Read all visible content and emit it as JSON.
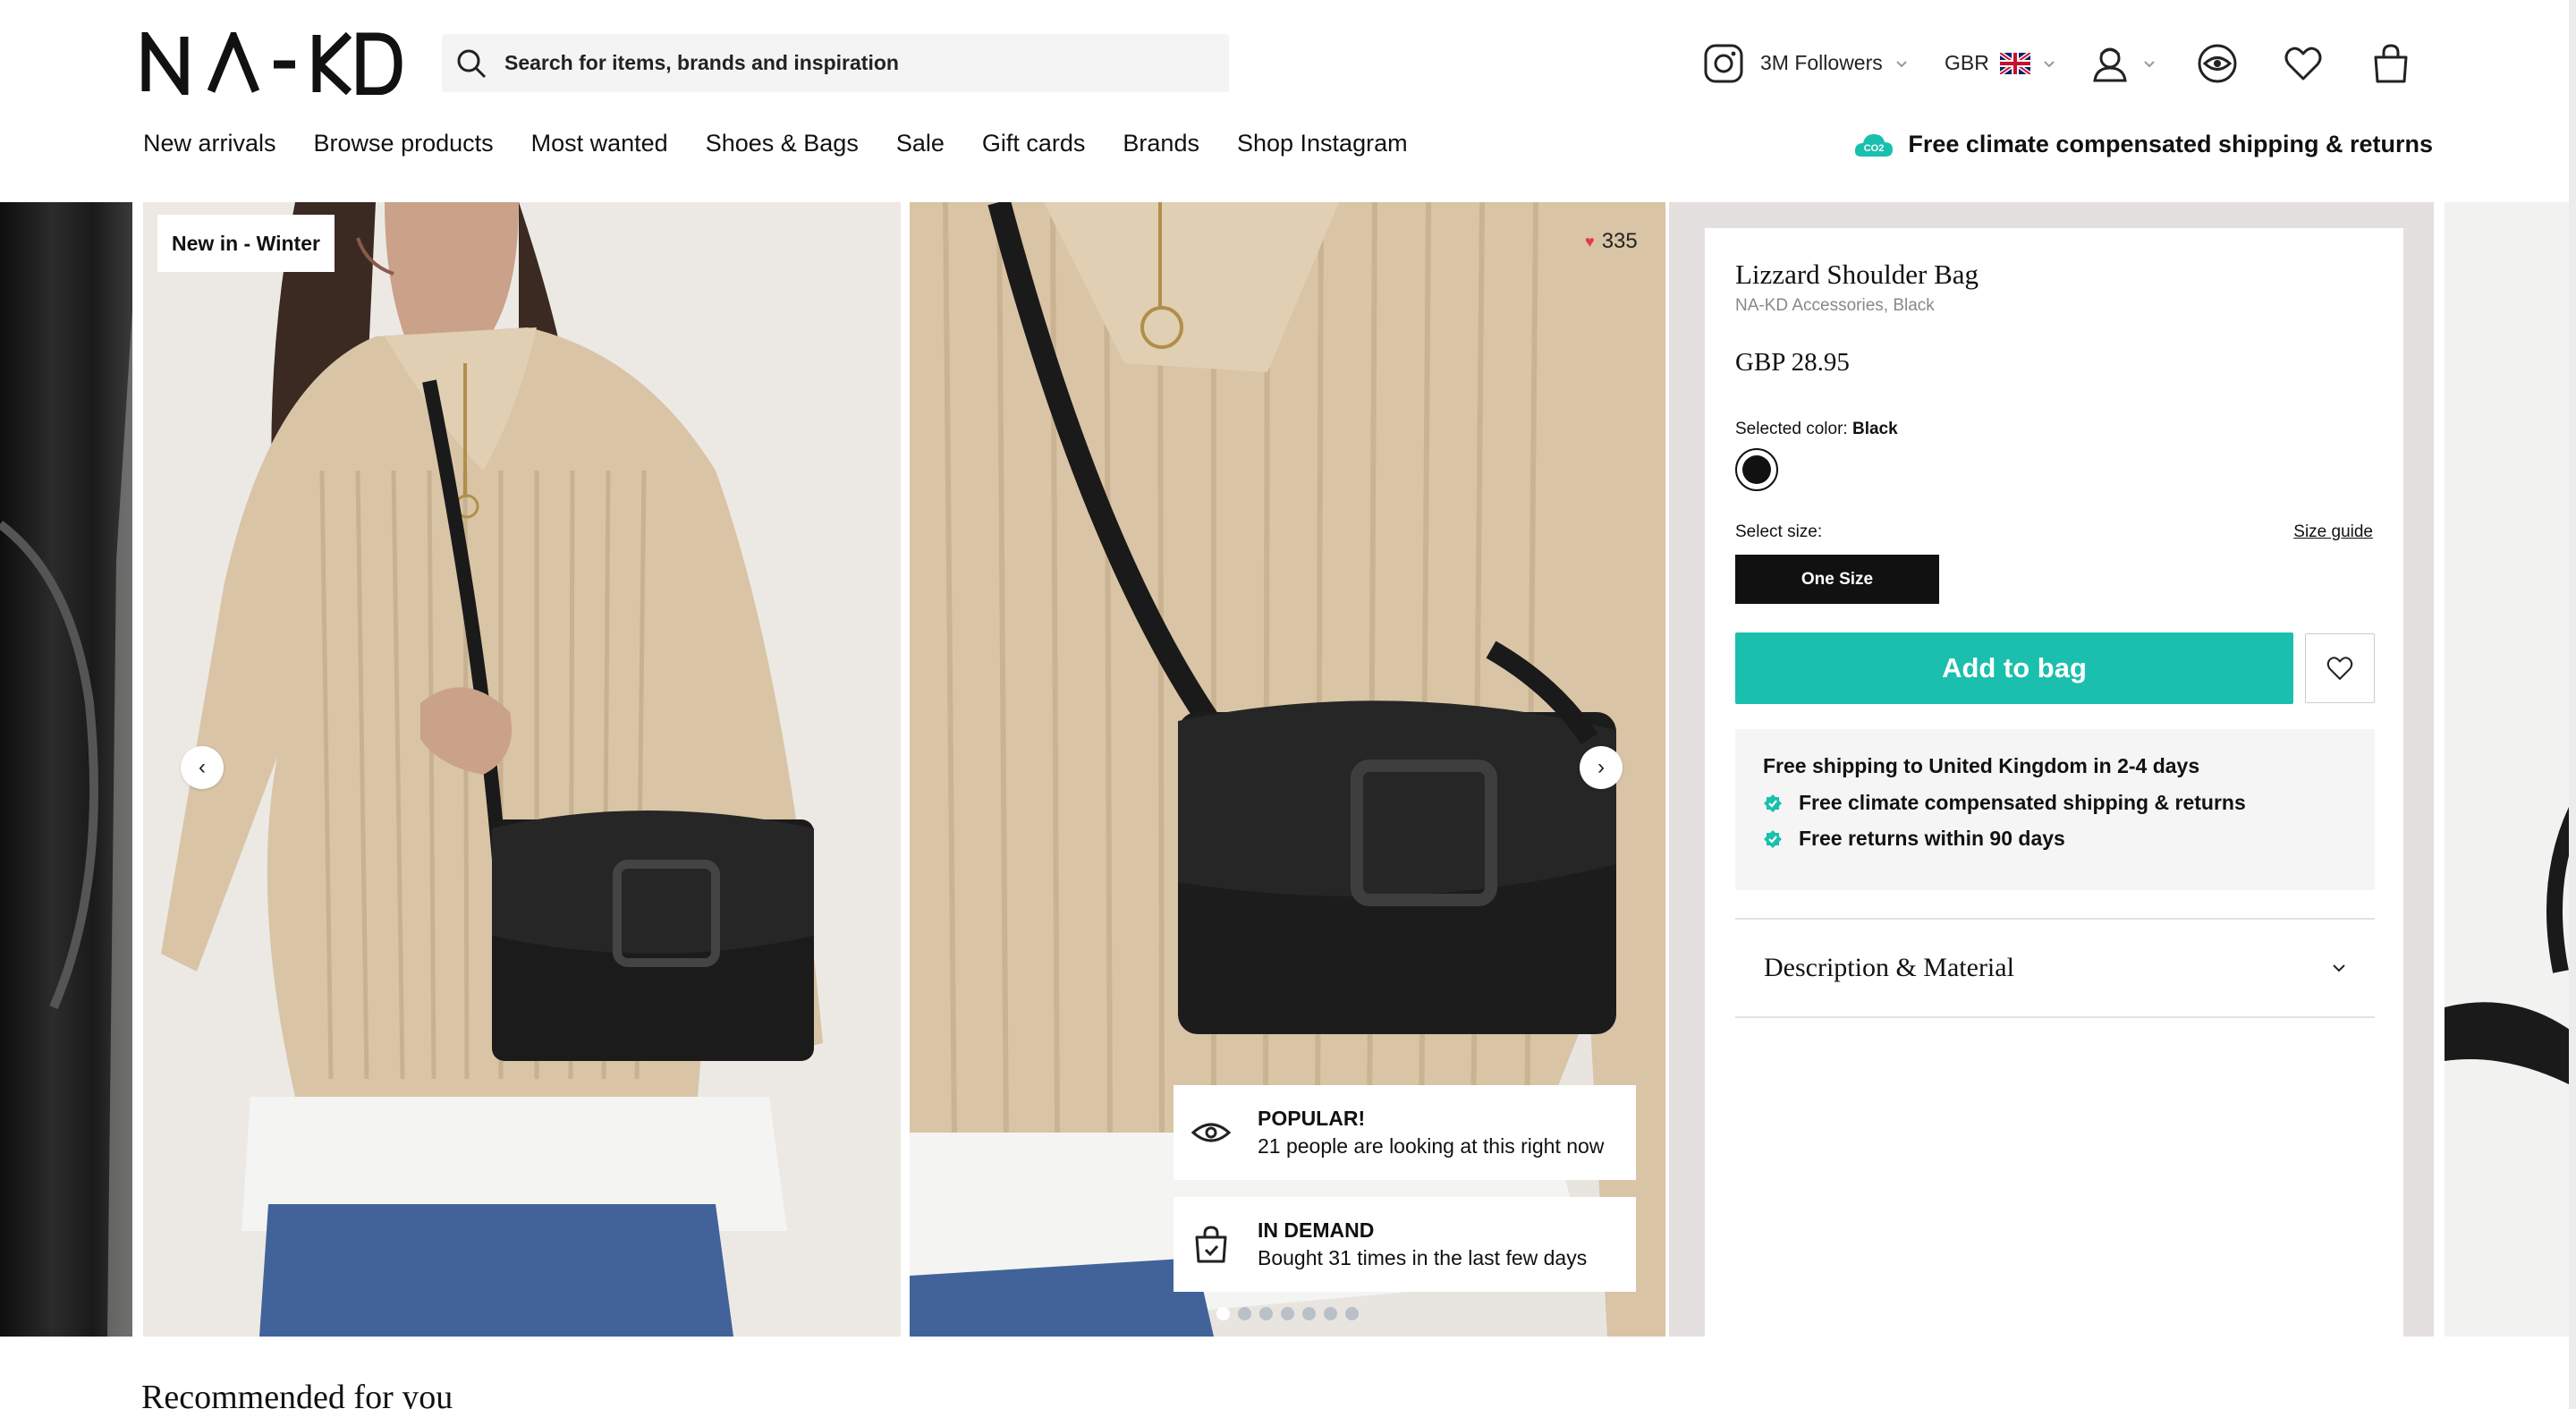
{
  "brand": {
    "logo_text": "NA-KD"
  },
  "search": {
    "placeholder": "Search for items, brands and inspiration"
  },
  "header": {
    "instagram_followers": "3M Followers",
    "country": "GBR",
    "icons": [
      "instagram-icon",
      "uk-flag-icon",
      "account-icon",
      "recently-viewed-icon",
      "wishlist-icon",
      "bag-icon"
    ]
  },
  "nav": {
    "items": [
      "New arrivals",
      "Browse products",
      "Most wanted",
      "Shoes & Bags",
      "Sale",
      "Gift cards",
      "Brands",
      "Shop Instagram"
    ]
  },
  "banner": {
    "shipping": "Free climate compensated shipping & returns",
    "co2_label": "CO2"
  },
  "gallery": {
    "badge": "New in - Winter",
    "likes": "335",
    "popular_title": "POPULAR!",
    "popular_text": "21 people are looking at this right now",
    "demand_title": "IN DEMAND",
    "demand_text": "Bought 31 times in the last few days",
    "dots_total": 7,
    "dots_active": 1
  },
  "product": {
    "name": "Lizzard Shoulder Bag",
    "brand_line": "NA-KD Accessories, Black",
    "price": "GBP 28.95",
    "selected_color_label": "Selected color:",
    "selected_color_value": "Black",
    "select_size_label": "Select size:",
    "size_guide": "Size guide",
    "size": "One Size",
    "add_to_bag": "Add to bag",
    "shipping_headline": "Free shipping to United Kingdom in 2-4 days",
    "perks": [
      "Free climate compensated shipping & returns",
      "Free returns within 90 days"
    ],
    "description_label": "Description & Material"
  },
  "colors": {
    "accent": "#1abfae",
    "heart": "#e63946",
    "panel_bg": "#e4e0df"
  },
  "recommended": {
    "title": "Recommended for you"
  }
}
